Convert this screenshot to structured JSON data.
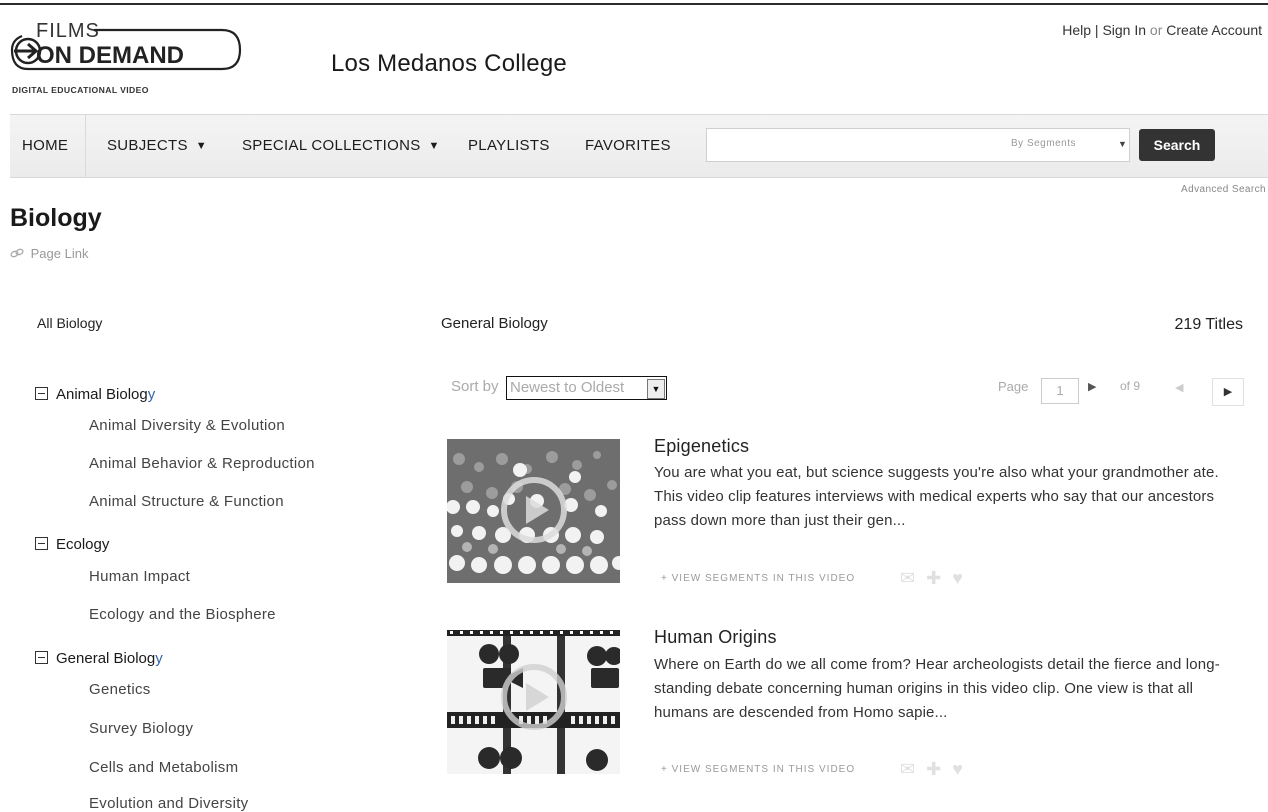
{
  "brand": {
    "logo_top": "FILMS",
    "logo_main": "ON DEMAND",
    "logo_tagline": "DIGITAL EDUCATIONAL VIDEO",
    "college": "Los Medanos College"
  },
  "account": {
    "help": "Help",
    "sep": "|",
    "sign_in": "Sign In",
    "or": "or",
    "create": "Create Account"
  },
  "nav": {
    "home": "HOME",
    "subjects": "SUBJECTS",
    "special_collections": "SPECIAL COLLECTIONS",
    "playlists": "PLAYLISTS",
    "favorites": "FAVORITES"
  },
  "search": {
    "value": "",
    "scope": "By Segments",
    "button": "Search",
    "advanced": "Advanced Search"
  },
  "page": {
    "title": "Biology",
    "page_link": "Page Link"
  },
  "columns": {
    "left": "All Biology",
    "middle": "General Biology",
    "count": "219 Titles"
  },
  "sidebar": {
    "categories": [
      {
        "prefix": "Animal Biolog",
        "accent": "y",
        "items": [
          "Animal Diversity & Evolution",
          "Animal Behavior & Reproduction",
          "Animal Structure & Function"
        ]
      },
      {
        "prefix": "Ecology",
        "accent": "",
        "items": [
          "Human Impact",
          "Ecology and the Biosphere"
        ]
      },
      {
        "prefix": "General Biolog",
        "accent": "y",
        "items": [
          "Genetics",
          "Survey Biology",
          "Cells and Metabolism",
          "Evolution and Diversity"
        ]
      }
    ]
  },
  "sort": {
    "label": "Sort by",
    "value": "Newest to Oldest"
  },
  "pagination": {
    "label": "Page",
    "current": "1",
    "of": "of 9"
  },
  "videos": [
    {
      "title": "Epigenetics",
      "description": "You are what you eat, but science suggests you're also what your grandmother ate. This video clip features interviews with medical experts who say that our ancestors pass down more than just their gen...",
      "segments_link": "+ VIEW SEGMENTS IN THIS VIDEO"
    },
    {
      "title": "Human Origins",
      "description": "Where on Earth do we all come from? Hear archeologists detail the fierce and long-standing debate concerning human origins in this video clip. One view is that all humans are descended from Homo sapie...",
      "segments_link": "+ VIEW SEGMENTS IN THIS VIDEO"
    }
  ],
  "colors": {
    "accent_link": "#3567a6",
    "search_button": "#333333",
    "nav_bg": "#efefef"
  },
  "icons": [
    "link-icon",
    "tree-collapse-icon",
    "caret-down-icon",
    "play-icon",
    "email-icon",
    "plus-icon",
    "heart-icon",
    "next-page-icon",
    "prev-page-icon"
  ]
}
